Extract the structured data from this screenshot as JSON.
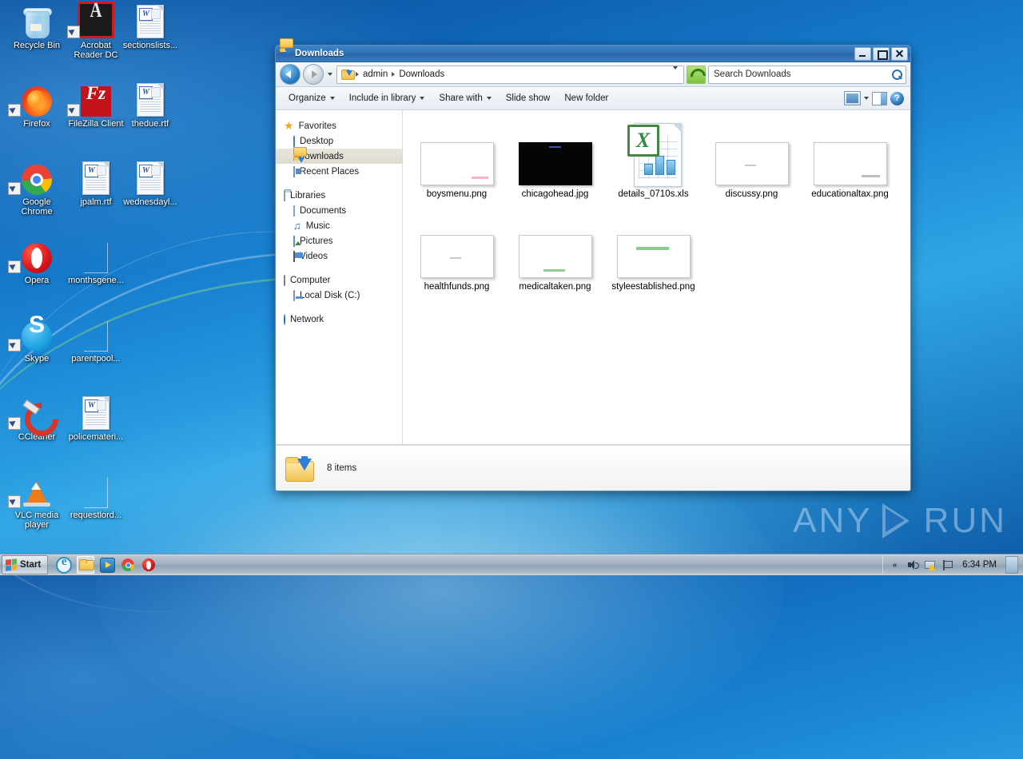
{
  "desktop": {
    "icons": [
      {
        "label": "Recycle Bin",
        "icon": "recycle-bin-icon",
        "type": "recycle",
        "shortcut": false
      },
      {
        "label": "Acrobat Reader DC",
        "icon": "acrobat-reader-icon",
        "type": "acrobat",
        "shortcut": true
      },
      {
        "label": "sectionslists...",
        "icon": "word-document-icon",
        "type": "doc",
        "shortcut": false
      },
      {
        "label": "Firefox",
        "icon": "firefox-icon",
        "type": "firefox",
        "shortcut": true
      },
      {
        "label": "FileZilla Client",
        "icon": "filezilla-icon",
        "type": "filezilla",
        "shortcut": true
      },
      {
        "label": "thedue.rtf",
        "icon": "word-document-icon",
        "type": "doc",
        "shortcut": false
      },
      {
        "label": "Google Chrome",
        "icon": "chrome-icon",
        "type": "chrome",
        "shortcut": true
      },
      {
        "label": "jpalm.rtf",
        "icon": "word-document-icon",
        "type": "doc",
        "shortcut": false
      },
      {
        "label": "wednesdayl...",
        "icon": "word-document-icon",
        "type": "doc",
        "shortcut": false
      },
      {
        "label": "Opera",
        "icon": "opera-icon",
        "type": "opera",
        "shortcut": true
      },
      {
        "label": "monthsgene...",
        "icon": "blank-document-icon",
        "type": "blank",
        "shortcut": false
      },
      {
        "label": "Skype",
        "icon": "skype-icon",
        "type": "skype",
        "shortcut": true
      },
      {
        "label": "parentpool...",
        "icon": "blank-document-icon",
        "type": "blank",
        "shortcut": false
      },
      {
        "label": "CCleaner",
        "icon": "ccleaner-icon",
        "type": "ccleaner",
        "shortcut": true
      },
      {
        "label": "policemateri...",
        "icon": "word-document-icon",
        "type": "doc",
        "shortcut": false
      },
      {
        "label": "VLC media player",
        "icon": "vlc-icon",
        "type": "vlc",
        "shortcut": true
      },
      {
        "label": "requestlord...",
        "icon": "blank-document-icon",
        "type": "blank",
        "shortcut": false
      }
    ]
  },
  "window": {
    "title": "Downloads",
    "titlebar_icon": "downloads-folder-icon",
    "buttons": {
      "minimize": "minimize-button",
      "maximize": "maximize-button",
      "close": "close-button"
    },
    "address": {
      "back_tooltip": "Back",
      "forward_tooltip": "Forward",
      "crumbs": [
        "admin",
        "Downloads"
      ],
      "refresh": "refresh-icon"
    },
    "search": {
      "placeholder": "Search Downloads",
      "value": "",
      "icon": "search-icon"
    },
    "toolbar": {
      "organize": "Organize",
      "include_in_library": "Include in library",
      "share_with": "Share with",
      "slide_show": "Slide show",
      "new_folder": "New folder",
      "view_icon": "change-view-icon",
      "preview_pane_icon": "preview-pane-icon",
      "help_icon": "help-icon",
      "help_glyph": "?"
    },
    "navpane": {
      "groups": [
        {
          "header": {
            "label": "Favorites",
            "icon": "star-icon",
            "kind": "star"
          },
          "items": [
            {
              "label": "Desktop",
              "icon": "desktop-icon",
              "kind": "desktop",
              "selected": false
            },
            {
              "label": "Downloads",
              "icon": "downloads-folder-icon",
              "kind": "downloads",
              "selected": true
            },
            {
              "label": "Recent Places",
              "icon": "recent-places-icon",
              "kind": "recent",
              "selected": false
            }
          ]
        },
        {
          "header": {
            "label": "Libraries",
            "icon": "libraries-icon",
            "kind": "lib"
          },
          "items": [
            {
              "label": "Documents",
              "icon": "documents-icon",
              "kind": "docs",
              "selected": false
            },
            {
              "label": "Music",
              "icon": "music-icon",
              "kind": "music",
              "selected": false
            },
            {
              "label": "Pictures",
              "icon": "pictures-icon",
              "kind": "pic",
              "selected": false
            },
            {
              "label": "Videos",
              "icon": "videos-icon",
              "kind": "vid",
              "selected": false
            }
          ]
        },
        {
          "header": {
            "label": "Computer",
            "icon": "computer-icon",
            "kind": "comp"
          },
          "items": [
            {
              "label": "Local Disk (C:)",
              "icon": "local-disk-icon",
              "kind": "disk",
              "selected": false
            }
          ]
        },
        {
          "header": {
            "label": "Network",
            "icon": "network-icon",
            "kind": "net"
          },
          "items": []
        }
      ]
    },
    "files": [
      {
        "name": "boysmenu.png",
        "thumb": "image-thumbnail",
        "style": "light",
        "marks": [
          "pink"
        ]
      },
      {
        "name": "chicagohead.jpg",
        "thumb": "image-thumbnail",
        "style": "dark",
        "marks": [
          "blue"
        ]
      },
      {
        "name": "details_0710s.xls",
        "thumb": "excel-file-icon",
        "style": "xls",
        "marks": []
      },
      {
        "name": "discussy.png",
        "thumb": "image-thumbnail",
        "style": "light",
        "marks": [
          "gray"
        ]
      },
      {
        "name": "educationaltax.png",
        "thumb": "image-thumbnail",
        "style": "light",
        "marks": [
          "silver"
        ]
      },
      {
        "name": "healthfunds.png",
        "thumb": "image-thumbnail",
        "style": "light",
        "marks": [
          "gray"
        ]
      },
      {
        "name": "medicaltaken.png",
        "thumb": "image-thumbnail",
        "style": "light",
        "marks": [
          "green"
        ]
      },
      {
        "name": "styleestablished.png",
        "thumb": "image-thumbnail",
        "style": "light",
        "marks": [
          "green2"
        ]
      }
    ],
    "status": {
      "icon": "downloads-folder-icon",
      "text": "8 items"
    }
  },
  "watermark": {
    "left": "ANY",
    "right": "RUN",
    "logo": "play-triangle-icon"
  },
  "taskbar": {
    "start_label": "Start",
    "start_icon": "windows-logo-icon",
    "quick_launch": [
      {
        "name": "internet-explorer-icon",
        "kind": "ie",
        "active": false
      },
      {
        "name": "windows-explorer-icon",
        "kind": "exp",
        "active": true
      },
      {
        "name": "windows-media-player-icon",
        "kind": "wmp",
        "active": false
      },
      {
        "name": "chrome-icon",
        "kind": "chrome",
        "active": false
      },
      {
        "name": "opera-icon",
        "kind": "opera",
        "active": false
      }
    ],
    "tray": [
      {
        "name": "show-hidden-icons-chevron",
        "kind": "chev",
        "glyph": "«"
      },
      {
        "name": "volume-icon",
        "kind": "vol",
        "glyph": ""
      },
      {
        "name": "network-warning-icon",
        "kind": "net",
        "glyph": ""
      },
      {
        "name": "action-center-flag-icon",
        "kind": "flag",
        "glyph": ""
      }
    ],
    "clock": "6:34 PM",
    "show_desktop": "show-desktop-button"
  }
}
